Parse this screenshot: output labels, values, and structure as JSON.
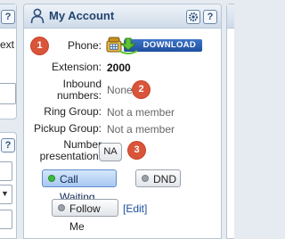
{
  "left_panel": {
    "help": "?",
    "text_fragment": "ext"
  },
  "left_panel2": {
    "help": "?"
  },
  "panel": {
    "title": "My Account",
    "settings_icon": "gear-icon",
    "help_label": "?"
  },
  "fields": {
    "phone_label": "Phone:",
    "download_label": "DOWNLOAD",
    "extension_label": "Extension:",
    "extension_value": "2000",
    "inbound_label_line1": "Inbound",
    "inbound_label_line2": "numbers:",
    "inbound_value": "None",
    "ring_group_label": "Ring Group:",
    "ring_group_value": "Not a member",
    "pickup_group_label": "Pickup Group:",
    "pickup_group_value": "Not a member",
    "presentation_label_line1": "Number",
    "presentation_label_line2": "presentation:",
    "presentation_value": "NA"
  },
  "badges": [
    "1",
    "2",
    "3"
  ],
  "buttons": {
    "call_waiting": "Call Waiting",
    "dnd": "DND",
    "follow_me": "Follow Me",
    "edit": "[Edit]"
  },
  "colors": {
    "header_title": "#22446f",
    "badge": "#d9553a",
    "download_bg": "#2a5db0",
    "active_button": "#a8c8f0",
    "status_green": "#3cbb3c"
  }
}
